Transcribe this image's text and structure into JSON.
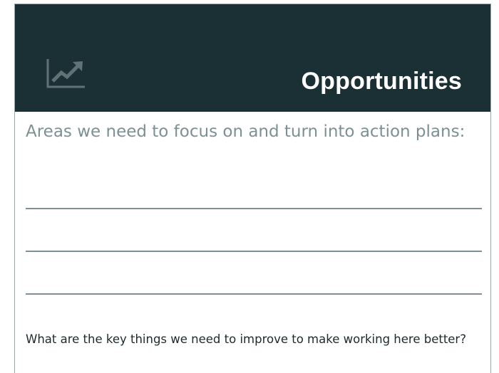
{
  "header": {
    "icon": "trending-up-chart-icon",
    "title": "Opportunities",
    "background_color": "#1a3034",
    "title_color": "#ffffff",
    "icon_color": "#5f7377"
  },
  "prompt": {
    "text": "Areas we need to focus on and turn into action plans:",
    "color": "#7d9093"
  },
  "answer_lines": [
    {
      "id": "line-1"
    },
    {
      "id": "line-2"
    },
    {
      "id": "line-3"
    }
  ],
  "question": {
    "text": "What are the key things we need to improve to make working here better?",
    "color": "#1e2a2d"
  }
}
